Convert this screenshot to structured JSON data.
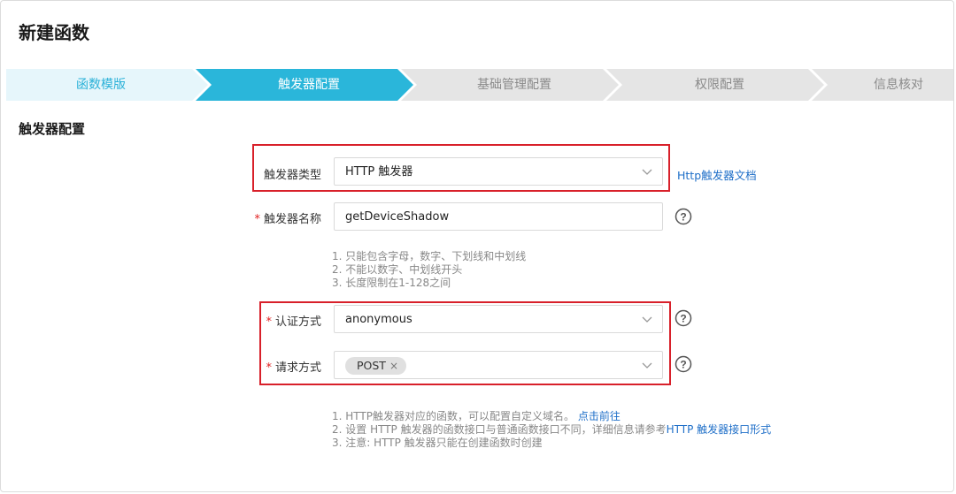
{
  "page": {
    "title": "新建函数",
    "section_title": "触发器配置"
  },
  "steps": [
    {
      "label": "函数模版",
      "state": "done"
    },
    {
      "label": "触发器配置",
      "state": "active"
    },
    {
      "label": "基础管理配置",
      "state": "todo"
    },
    {
      "label": "权限配置",
      "state": "todo"
    },
    {
      "label": "信息核对",
      "state": "todo"
    }
  ],
  "colors": {
    "done": "#e6f6fb",
    "active": "#2ab6da",
    "todo": "#e5e5e5",
    "highlight_box": "#d8202a",
    "link": "#1f6fc8"
  },
  "form": {
    "trigger_type": {
      "label": "触发器类型",
      "value": "HTTP 触发器",
      "doc_link": "Http触发器文档"
    },
    "trigger_name": {
      "label": "触发器名称",
      "value": "getDeviceShadow",
      "rules": [
        "1. 只能包含字母，数字、下划线和中划线",
        "2. 不能以数字、中划线开头",
        "3. 长度限制在1-128之间"
      ]
    },
    "auth_method": {
      "label": "认证方式",
      "value": "anonymous"
    },
    "request_method": {
      "label": "请求方式",
      "tag": "POST",
      "tag_remove": "×"
    },
    "notes": {
      "line1": "1. HTTP触发器对应的函数，可以配置自定义域名。",
      "line1_link": "点击前往",
      "line2": "2. 设置 HTTP 触发器的函数接口与普通函数接口不同，详细信息请参考",
      "line2_link": "HTTP 触发器接口形式",
      "line3": "3. 注意: HTTP 触发器只能在创建函数时创建"
    },
    "required_mark": "*"
  }
}
